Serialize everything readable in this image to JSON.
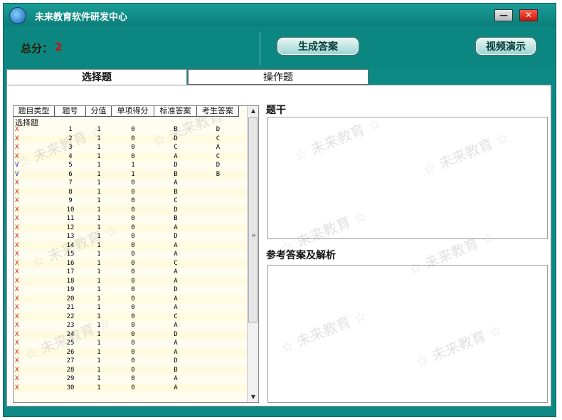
{
  "window": {
    "title": "未来教育软件研发中心",
    "minimize": "—",
    "close": "✕",
    "logo_text": "未来教育"
  },
  "score": {
    "label": "总分：",
    "value": "2"
  },
  "actions": {
    "generate": "生成答案",
    "video": "视频演示"
  },
  "tabs": [
    "选择题",
    "操作题"
  ],
  "list": {
    "columns": [
      "题目类型",
      "题号",
      "分值",
      "单项得分",
      "标准答案",
      "考生答案"
    ],
    "group_label": "选择题",
    "rows": [
      {
        "mark": "X",
        "num": "1",
        "pts": "1",
        "score": "0",
        "std": "B",
        "ans": "D"
      },
      {
        "mark": "X",
        "num": "2",
        "pts": "1",
        "score": "0",
        "std": "D",
        "ans": "C"
      },
      {
        "mark": "X",
        "num": "3",
        "pts": "1",
        "score": "0",
        "std": "C",
        "ans": "A"
      },
      {
        "mark": "X",
        "num": "4",
        "pts": "1",
        "score": "0",
        "std": "A",
        "ans": "C"
      },
      {
        "mark": "V",
        "num": "5",
        "pts": "1",
        "score": "1",
        "std": "D",
        "ans": "D"
      },
      {
        "mark": "V",
        "num": "6",
        "pts": "1",
        "score": "1",
        "std": "B",
        "ans": "B"
      },
      {
        "mark": "X",
        "num": "7",
        "pts": "1",
        "score": "0",
        "std": "A",
        "ans": ""
      },
      {
        "mark": "X",
        "num": "8",
        "pts": "1",
        "score": "0",
        "std": "B",
        "ans": ""
      },
      {
        "mark": "X",
        "num": "9",
        "pts": "1",
        "score": "0",
        "std": "C",
        "ans": ""
      },
      {
        "mark": "X",
        "num": "10",
        "pts": "1",
        "score": "0",
        "std": "D",
        "ans": ""
      },
      {
        "mark": "X",
        "num": "11",
        "pts": "1",
        "score": "0",
        "std": "B",
        "ans": ""
      },
      {
        "mark": "X",
        "num": "12",
        "pts": "1",
        "score": "0",
        "std": "A",
        "ans": ""
      },
      {
        "mark": "X",
        "num": "13",
        "pts": "1",
        "score": "0",
        "std": "D",
        "ans": ""
      },
      {
        "mark": "X",
        "num": "14",
        "pts": "1",
        "score": "0",
        "std": "A",
        "ans": ""
      },
      {
        "mark": "X",
        "num": "15",
        "pts": "1",
        "score": "0",
        "std": "A",
        "ans": ""
      },
      {
        "mark": "X",
        "num": "16",
        "pts": "1",
        "score": "0",
        "std": "C",
        "ans": ""
      },
      {
        "mark": "X",
        "num": "17",
        "pts": "1",
        "score": "0",
        "std": "A",
        "ans": ""
      },
      {
        "mark": "X",
        "num": "18",
        "pts": "1",
        "score": "0",
        "std": "A",
        "ans": ""
      },
      {
        "mark": "X",
        "num": "19",
        "pts": "1",
        "score": "0",
        "std": "D",
        "ans": ""
      },
      {
        "mark": "X",
        "num": "20",
        "pts": "1",
        "score": "0",
        "std": "A",
        "ans": ""
      },
      {
        "mark": "X",
        "num": "21",
        "pts": "1",
        "score": "0",
        "std": "A",
        "ans": ""
      },
      {
        "mark": "X",
        "num": "22",
        "pts": "1",
        "score": "0",
        "std": "C",
        "ans": ""
      },
      {
        "mark": "X",
        "num": "23",
        "pts": "1",
        "score": "0",
        "std": "A",
        "ans": ""
      },
      {
        "mark": "X",
        "num": "24",
        "pts": "1",
        "score": "0",
        "std": "D",
        "ans": ""
      },
      {
        "mark": "X",
        "num": "25",
        "pts": "1",
        "score": "0",
        "std": "A",
        "ans": ""
      },
      {
        "mark": "X",
        "num": "26",
        "pts": "1",
        "score": "0",
        "std": "A",
        "ans": ""
      },
      {
        "mark": "X",
        "num": "27",
        "pts": "1",
        "score": "0",
        "std": "D",
        "ans": ""
      },
      {
        "mark": "X",
        "num": "28",
        "pts": "1",
        "score": "0",
        "std": "B",
        "ans": ""
      },
      {
        "mark": "X",
        "num": "29",
        "pts": "1",
        "score": "0",
        "std": "A",
        "ans": ""
      },
      {
        "mark": "X",
        "num": "30",
        "pts": "1",
        "score": "0",
        "std": "A",
        "ans": ""
      }
    ]
  },
  "scrollbar": {
    "up_icon": "up-arrow-icon",
    "down_icon": "down-arrow-icon",
    "grip": "≡"
  },
  "panels": {
    "stem_title": "题干",
    "answer_title": "参考答案及解析"
  },
  "watermark": "☆ 未来教育 ☆",
  "colors": {
    "frame": "#0d8a86",
    "wrong_mark": "#c81414",
    "right_mark": "#1a22b8",
    "score_value": "#d01010"
  }
}
